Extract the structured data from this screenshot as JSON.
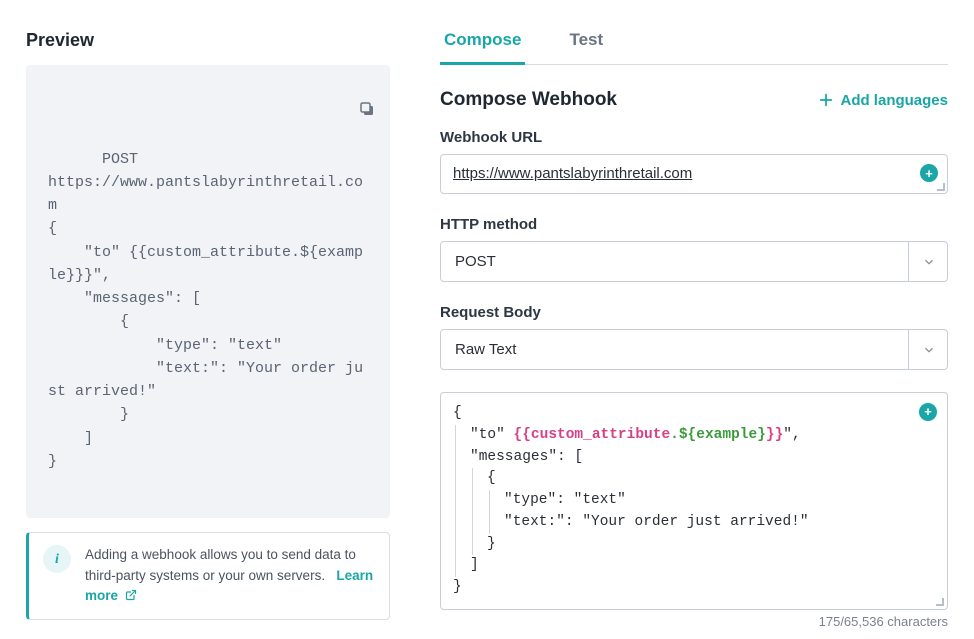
{
  "preview": {
    "title": "Preview",
    "code": "POST\nhttps://www.pantslabyrinthretail.com\n{\n    \"to\" {{custom_attribute.${example}}}\",\n    \"messages\": [\n        {\n            \"type\": \"text\"\n            \"text:\": \"Your order just arrived!\"\n        }\n    ]\n}",
    "info_text": "Adding a webhook allows you to send data to third-party systems or your own servers.",
    "learn_more": "Learn more"
  },
  "tabs": {
    "compose": "Compose",
    "test": "Test"
  },
  "compose": {
    "title": "Compose Webhook",
    "add_languages": "Add languages",
    "url_label": "Webhook URL",
    "url_value": "https://www.pantslabyrinthretail.com",
    "method_label": "HTTP method",
    "method_value": "POST",
    "body_label": "Request Body",
    "body_type": "Raw Text",
    "body_json": {
      "to_key": "\"to\" ",
      "token_open": "{{",
      "token_obj": "custom_attribute",
      "token_dot": ".",
      "token_attr": "${example}",
      "token_close": "}}",
      "to_tail": "\",",
      "messages_key": "\"messages\": [",
      "type_line": "\"type\": \"text\"",
      "text_line": "\"text:\": \"Your order just arrived!\""
    },
    "char_count": "175/65,536 characters"
  }
}
